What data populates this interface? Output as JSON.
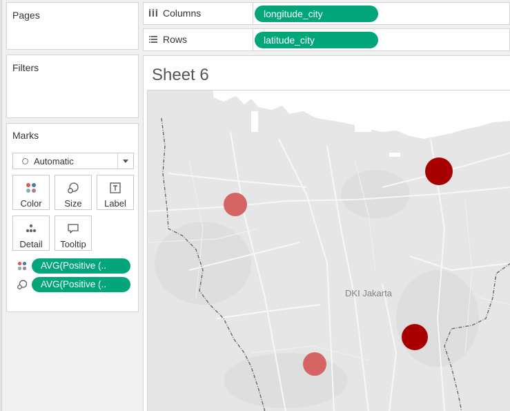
{
  "panels": {
    "pages": {
      "title": "Pages"
    },
    "filters": {
      "title": "Filters"
    },
    "marks": {
      "title": "Marks",
      "mark_type": "Automatic",
      "buttons": [
        {
          "label": "Color",
          "icon": "color-dots-icon"
        },
        {
          "label": "Size",
          "icon": "size-icon"
        },
        {
          "label": "Label",
          "icon": "label-icon"
        },
        {
          "label": "Detail",
          "icon": "detail-dots-icon"
        },
        {
          "label": "Tooltip",
          "icon": "tooltip-icon"
        }
      ],
      "encodings": [
        {
          "type": "color",
          "icon": "color-dots-icon",
          "field": "AVG(Positive (.."
        },
        {
          "type": "size",
          "icon": "size-icon",
          "field": "AVG(Positive (.."
        }
      ]
    }
  },
  "shelves": {
    "columns": {
      "label": "Columns",
      "icon": "columns-icon",
      "field": "longitude_city"
    },
    "rows": {
      "label": "Rows",
      "icon": "rows-icon",
      "field": "latitude_city"
    }
  },
  "sheet": {
    "title": "Sheet 6",
    "map_label": "DKI Jakarta"
  },
  "map_marks": {
    "colors": {
      "high": "#a80000",
      "low": "#d56565"
    },
    "points": [
      {
        "level": "high"
      },
      {
        "level": "low"
      },
      {
        "level": "high"
      },
      {
        "level": "low"
      }
    ]
  }
}
